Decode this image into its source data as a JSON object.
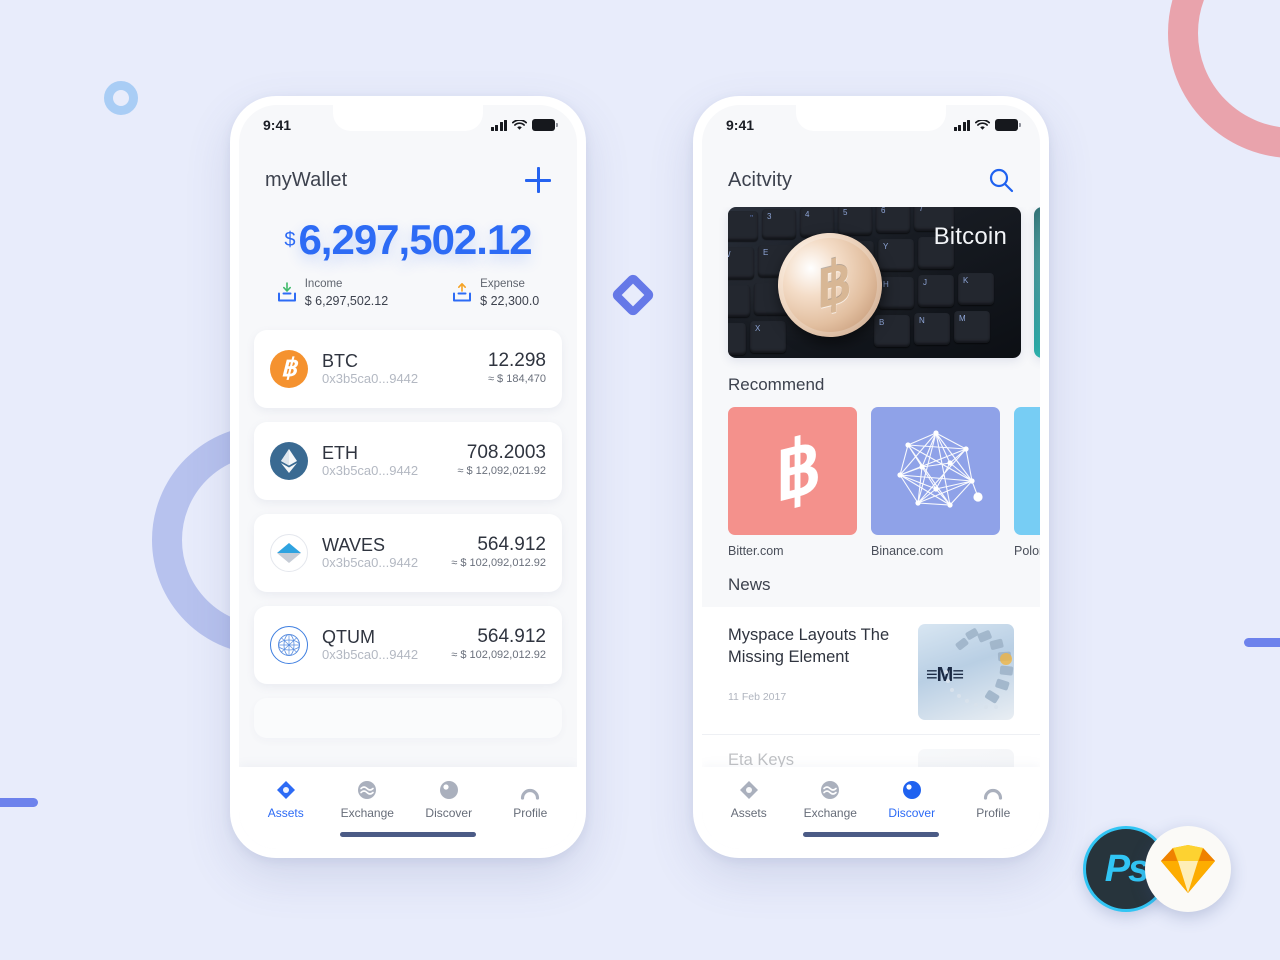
{
  "wallet": {
    "status": {
      "time": "9:41"
    },
    "header": {
      "title": "myWallet",
      "add_icon": "plus-icon"
    },
    "balance": {
      "currency_symbol": "$",
      "amount": "6,297,502.12"
    },
    "income": {
      "icon": "download-tray-icon",
      "label": "Income",
      "value": "$ 6,297,502.12"
    },
    "expense": {
      "icon": "upload-tray-icon",
      "label": "Expense",
      "value": "$ 22,300.0"
    },
    "assets": [
      {
        "icon": "bitcoin-icon",
        "name": "BTC",
        "address": "0x3b5ca0...9442",
        "amount": "12.298",
        "fiat": "≈ $ 184,470"
      },
      {
        "icon": "ethereum-icon",
        "name": "ETH",
        "address": "0x3b5ca0...9442",
        "amount": "708.2003",
        "fiat": "≈ $ 12,092,021.92"
      },
      {
        "icon": "waves-icon",
        "name": "WAVES",
        "address": "0x3b5ca0...9442",
        "amount": "564.912",
        "fiat": "≈ $ 102,092,012.92"
      },
      {
        "icon": "qtum-icon",
        "name": "QTUM",
        "address": "0x3b5ca0...9442",
        "amount": "564.912",
        "fiat": "≈ $ 102,092,012.92"
      }
    ],
    "tabs": [
      {
        "icon": "assets-diamond-icon",
        "label": "Assets",
        "active": true
      },
      {
        "icon": "exchange-wave-icon",
        "label": "Exchange",
        "active": false
      },
      {
        "icon": "discover-compass-icon",
        "label": "Discover",
        "active": false
      },
      {
        "icon": "profile-person-icon",
        "label": "Profile",
        "active": false
      }
    ]
  },
  "discover": {
    "status": {
      "time": "9:41"
    },
    "header": {
      "title": "Acitvity",
      "search_icon": "search-icon"
    },
    "banners": [
      {
        "label": "Bitcoin",
        "art": "bitcoin-coin-on-keyboard"
      },
      {
        "label": "",
        "art": "teal-abstract"
      }
    ],
    "recommend": {
      "title": "Recommend",
      "items": [
        {
          "name": "Bitter.com",
          "color": "#f4918c",
          "icon": "bitcoin-b-icon"
        },
        {
          "name": "Binance.com",
          "color": "#8fa2e8",
          "icon": "network-graph-icon"
        },
        {
          "name": "Poloni",
          "color": "#77cdf4",
          "icon": "sparkle-icon"
        }
      ]
    },
    "news": {
      "title": "News",
      "items": [
        {
          "title": "Myspace Layouts The Missing Element",
          "date": "11 Feb 2017",
          "thumb": "ibm-server-photo"
        },
        {
          "title": "Eta Keys",
          "date": "",
          "thumb": "portrait-photo"
        }
      ]
    },
    "tabs": [
      {
        "icon": "assets-diamond-icon",
        "label": "Assets",
        "active": false
      },
      {
        "icon": "exchange-wave-icon",
        "label": "Exchange",
        "active": false
      },
      {
        "icon": "discover-compass-icon",
        "label": "Discover",
        "active": true
      },
      {
        "icon": "profile-person-icon",
        "label": "Profile",
        "active": false
      }
    ]
  },
  "badges": {
    "photoshop": "Ps",
    "sketch": "sketch-diamond-icon"
  },
  "colors": {
    "accent": "#2d6bf5",
    "bg": "#e8ecfb",
    "pink": "#e9a3ac",
    "periwinkle": "#b7c2ee"
  }
}
